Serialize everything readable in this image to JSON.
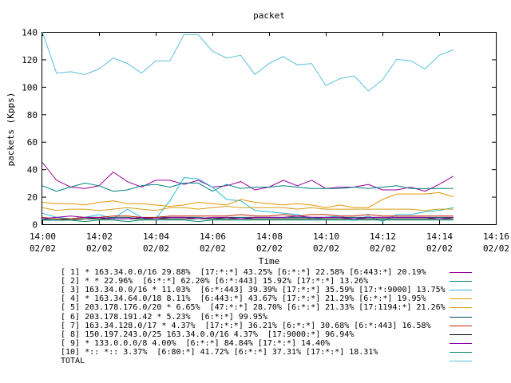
{
  "colors": {
    "axis": "#000000",
    "background": "#ffffff"
  },
  "chart_data": {
    "type": "line",
    "title": "packet",
    "xlabel": "Time",
    "ylabel": "packets (Kpps)",
    "ylim": [
      0,
      140
    ],
    "yticks": [
      "0",
      "20",
      "40",
      "60",
      "80",
      "100",
      "120",
      "140"
    ],
    "xticks": [
      {
        "time": "14:00",
        "date": "02/02"
      },
      {
        "time": "14:02",
        "date": "02/02"
      },
      {
        "time": "14:04",
        "date": "02/02"
      },
      {
        "time": "14:06",
        "date": "02/02"
      },
      {
        "time": "14:08",
        "date": "02/02"
      },
      {
        "time": "14:10",
        "date": "02/02"
      },
      {
        "time": "14:12",
        "date": "02/02"
      },
      {
        "time": "14:14",
        "date": "02/02"
      },
      {
        "time": "14:16",
        "date": "02/02"
      }
    ],
    "x": [
      "14:00",
      "14:00:30",
      "14:01",
      "14:01:30",
      "14:02",
      "14:02:30",
      "14:03",
      "14:03:30",
      "14:04",
      "14:04:30",
      "14:05",
      "14:05:30",
      "14:06",
      "14:06:30",
      "14:07",
      "14:07:30",
      "14:08",
      "14:08:30",
      "14:09",
      "14:09:30",
      "14:10",
      "14:10:30",
      "14:11",
      "14:11:30",
      "14:12",
      "14:12:30",
      "14:13",
      "14:13:30",
      "14:14",
      "14:14:30"
    ],
    "series": [
      {
        "name": "[ 1] * 163.34.0.0/16 29.88%  [17:*:*] 43.25% [6:*:*] 22.58% [6:443:*] 20.19%",
        "color": "#990099",
        "values": [
          45,
          32,
          27,
          26,
          28,
          38,
          31,
          27,
          32,
          32,
          29,
          32,
          27,
          28,
          31,
          25,
          27,
          32,
          28,
          32,
          26,
          27,
          27,
          29,
          25,
          25,
          27,
          24,
          29,
          35
        ]
      },
      {
        "name": "[ 2] * * 22.96%  [6:*:*] 62.20% [6:*:443] 15.92% [17:*:*] 13.26%",
        "color": "#008080",
        "values": [
          28,
          24,
          27,
          30,
          28,
          24,
          25,
          28,
          29,
          27,
          30,
          30,
          24,
          29,
          26,
          27,
          27,
          28,
          27,
          26,
          26,
          26,
          27,
          26,
          27,
          28,
          26,
          26,
          26,
          26
        ]
      },
      {
        "name": "[ 3] 163.34.0.0/16 * 11.03%  [6:*:443] 39.39% [17:*:*] 35.59% [17:*:9000] 13.75%",
        "color": "#22bbdd",
        "values": [
          8,
          5,
          4,
          5,
          7,
          4,
          11,
          5,
          4,
          17,
          34,
          33,
          27,
          18,
          17,
          10,
          9,
          8,
          7,
          4,
          5,
          6,
          3,
          6,
          2,
          7,
          7,
          9,
          10,
          12
        ]
      },
      {
        "name": "[ 4] * 163.34.64.0/18 8.11%  [6:443:*] 43.67% [17:*:*] 21.29% [6:*:*] 19.95%",
        "color": "#e69500",
        "values": [
          16,
          15,
          15,
          14,
          16,
          17,
          15,
          15,
          14,
          13,
          14,
          16,
          15,
          14,
          18,
          16,
          15,
          14,
          15,
          14,
          12,
          14,
          12,
          12,
          18,
          22,
          22,
          22,
          23,
          20
        ]
      },
      {
        "name": "[ 5] 203.178.176.0/20 * 6.65%  [47:*:*] 28.70% [6:*:*] 21.33% [17:1194:*] 21.26%",
        "color": "#d4a017",
        "values": [
          12,
          10,
          11,
          11,
          10,
          11,
          12,
          11,
          10,
          12,
          12,
          11,
          12,
          13,
          12,
          12,
          12,
          12,
          11,
          12,
          11,
          11,
          11,
          11,
          11,
          11,
          11,
          10,
          11,
          11
        ]
      },
      {
        "name": "[ 6] 203.178.191.42 * 5.23%  [6:*:*] 99.95%",
        "color": "#005060",
        "values": [
          4,
          3,
          4,
          5,
          4,
          5,
          5,
          4,
          5,
          5,
          5,
          5,
          4,
          5,
          5,
          5,
          5,
          5,
          5,
          5,
          5,
          5,
          5,
          5,
          5,
          5,
          5,
          5,
          5,
          5
        ]
      },
      {
        "name": "[ 7] 163.34.128.0/17 * 4.37%  [17:*:*] 36.21% [6:*:*] 30.68% [6:*:443] 16.58%",
        "color": "#cc2200",
        "values": [
          5,
          4,
          4,
          5,
          5,
          6,
          6,
          5,
          5,
          6,
          6,
          6,
          6,
          6,
          7,
          6,
          6,
          7,
          6,
          7,
          7,
          6,
          6,
          7,
          6,
          6,
          6,
          6,
          6,
          6
        ]
      },
      {
        "name": "[ 8] 150.197.243.0/25 163.34.0.0/16 4.37%  [17:9000:*] 96.94%",
        "color": "#000000",
        "values": [
          3,
          3,
          3,
          4,
          4,
          4,
          4,
          4,
          4,
          4,
          4,
          4,
          4,
          4,
          4,
          4,
          4,
          4,
          4,
          4,
          4,
          4,
          4,
          4,
          4,
          4,
          4,
          4,
          4,
          4
        ]
      },
      {
        "name": "[ 9] * 133.0.0.0/8 4.00%  [6:*:*] 84.84% [17:*:*] 14.40%",
        "color": "#8800aa",
        "values": [
          4,
          5,
          6,
          5,
          5,
          4,
          4,
          5,
          4,
          5,
          5,
          4,
          5,
          5,
          4,
          5,
          5,
          5,
          6,
          5,
          5,
          5,
          4,
          5,
          5,
          5,
          5,
          5,
          4,
          5
        ]
      },
      {
        "name": "[10] *:: *:: 3.37%  [6:80:*] 41.72% [6:*:*] 37.31% [17:*:*] 18.31%",
        "color": "#008866",
        "values": [
          3,
          3,
          3,
          2,
          3,
          3,
          2,
          3,
          3,
          3,
          3,
          2,
          3,
          3,
          3,
          3,
          3,
          3,
          3,
          3,
          3,
          3,
          3,
          3,
          3,
          3,
          3,
          3,
          3,
          3
        ]
      },
      {
        "name": "TOTAL",
        "color": "#5bc0de",
        "values": [
          140,
          110,
          111,
          109,
          113,
          121,
          117,
          110,
          119,
          119,
          138,
          138,
          126,
          121,
          123,
          109,
          117,
          122,
          116,
          117,
          101,
          106,
          108,
          97,
          105,
          120,
          119,
          113,
          123,
          127
        ]
      }
    ],
    "grid": false,
    "legend_position": "bottom"
  }
}
